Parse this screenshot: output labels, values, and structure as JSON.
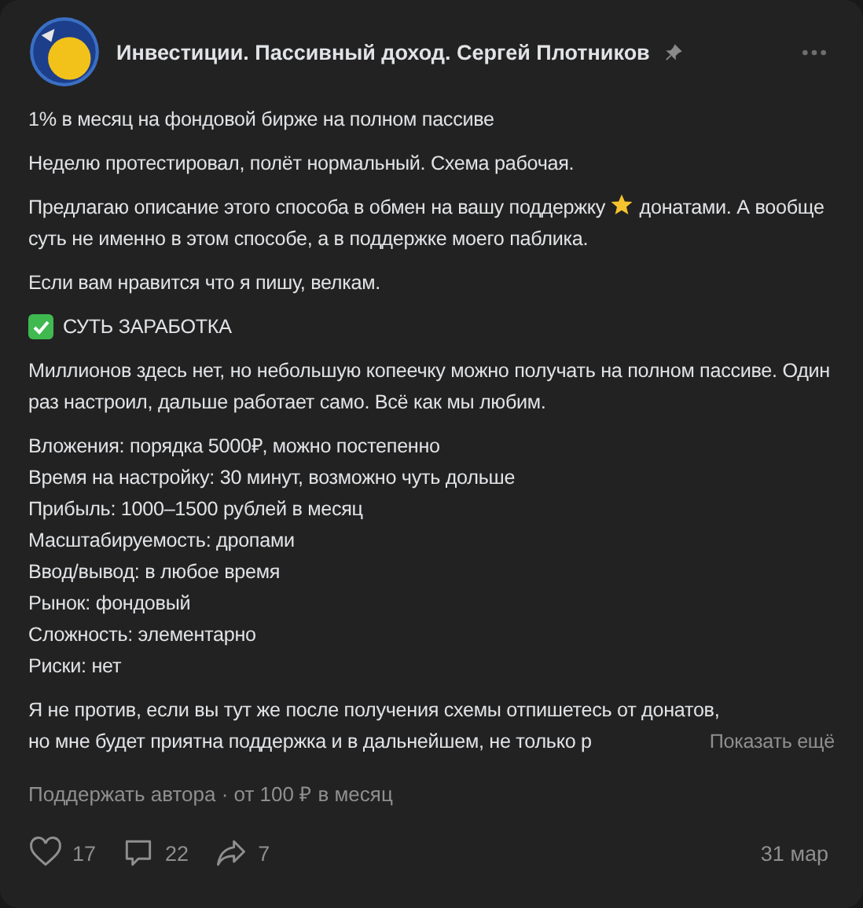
{
  "post": {
    "author": "Инвестиции. Пассивный доход. Сергей Плотников",
    "pinned": true,
    "blocks": [
      {
        "kind": "paragraph",
        "text": "1% в месяц на фондовой бирже на полном пассиве"
      },
      {
        "kind": "paragraph",
        "text": "Неделю протестировал, полёт нормальный. Схема рабочая."
      },
      {
        "kind": "inline-icon",
        "before": "Предлагаю описание этого способа в обмен на вашу поддержку",
        "after": "донатами. А вообще суть не именно в этом способе, а в поддержке моего паблика."
      },
      {
        "kind": "paragraph",
        "text": "Если вам нравится что я пишу, велкам."
      },
      {
        "kind": "heading",
        "text": "СУТЬ ЗАРАБОТКА"
      },
      {
        "kind": "paragraph",
        "text": "Миллионов здесь нет, но небольшую копеечку можно получать на полном пассиве. Один раз настроил, дальше работает само. Всё как мы любим."
      },
      {
        "kind": "lines",
        "lines": [
          "Вложения: порядка 5000₽, можно постепенно",
          "Время на настройку: 30 минут, возможно чуть дольше",
          "Прибыль: 1000–1500 рублей в месяц",
          "Масштабируемость: дропами",
          "Ввод/вывод: в любое время",
          "Рынок: фондовый",
          "Сложность: элементарно",
          "Риски: нет"
        ]
      },
      {
        "kind": "truncated",
        "lines": [
          "Я не против, если вы тут же после получения схемы отпишетесь от донатов,",
          "но мне будет приятна поддержка и в дальнейшем, не только р"
        ],
        "more": "Показать ещё"
      }
    ],
    "support": "Поддержать автора · от 100 ₽ в месяц",
    "likes": "17",
    "comments": "22",
    "shares": "7",
    "date": "31 мар"
  }
}
